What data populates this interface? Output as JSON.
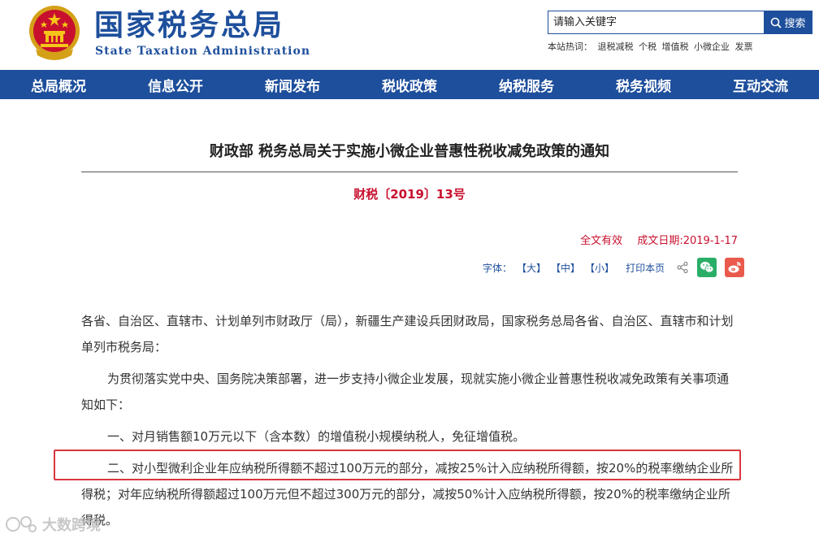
{
  "header": {
    "site_title": "国家税务总局",
    "site_subtitle": "State Taxation Administration",
    "search_placeholder": "请输入关键字",
    "search_button": "搜索",
    "hot_label": "本站热词：",
    "hot_words": [
      "退税减税",
      "个税",
      "增值税",
      "小微企业",
      "发票"
    ]
  },
  "nav": [
    "总局概况",
    "信息公开",
    "新闻发布",
    "税收政策",
    "纳税服务",
    "税务视频",
    "互动交流"
  ],
  "article": {
    "title": "财政部 税务总局关于实施小微企业普惠性税收减免政策的通知",
    "doc_number": "财税〔2019〕13号",
    "validity": "全文有效",
    "date": "成文日期:2019-1-17",
    "tools": {
      "font_label": "字体：",
      "large": "【大】",
      "medium": "【中】",
      "small": "【小】",
      "print": "打印本页"
    },
    "paragraphs": [
      "各省、自治区、直辖市、计划单列市财政厅（局），新疆生产建设兵团财政局，国家税务总局各省、自治区、直辖市和计划单列市税务局：",
      "为贯彻落实党中央、国务院决策部署，进一步支持小微企业发展，现就实施小微企业普惠性税收减免政策有关事项通知如下：",
      "一、对月销售额10万元以下（含本数）的增值税小规模纳税人，免征增值税。",
      "二、对小型微利企业年应纳税所得额不超过100万元的部分，减按25%计入应纳税所得额，按20%的税率缴纳企业所得税；对年应纳税所得额超过100万元但不超过300万元的部分，减按50%计入应纳税所得额，按20%的税率缴纳企业所得税。"
    ]
  },
  "watermark": "大数跨境",
  "colors": {
    "brand_blue": "#1e4f9c",
    "accent_red": "#c8102e",
    "highlight_border": "#d9363e"
  }
}
